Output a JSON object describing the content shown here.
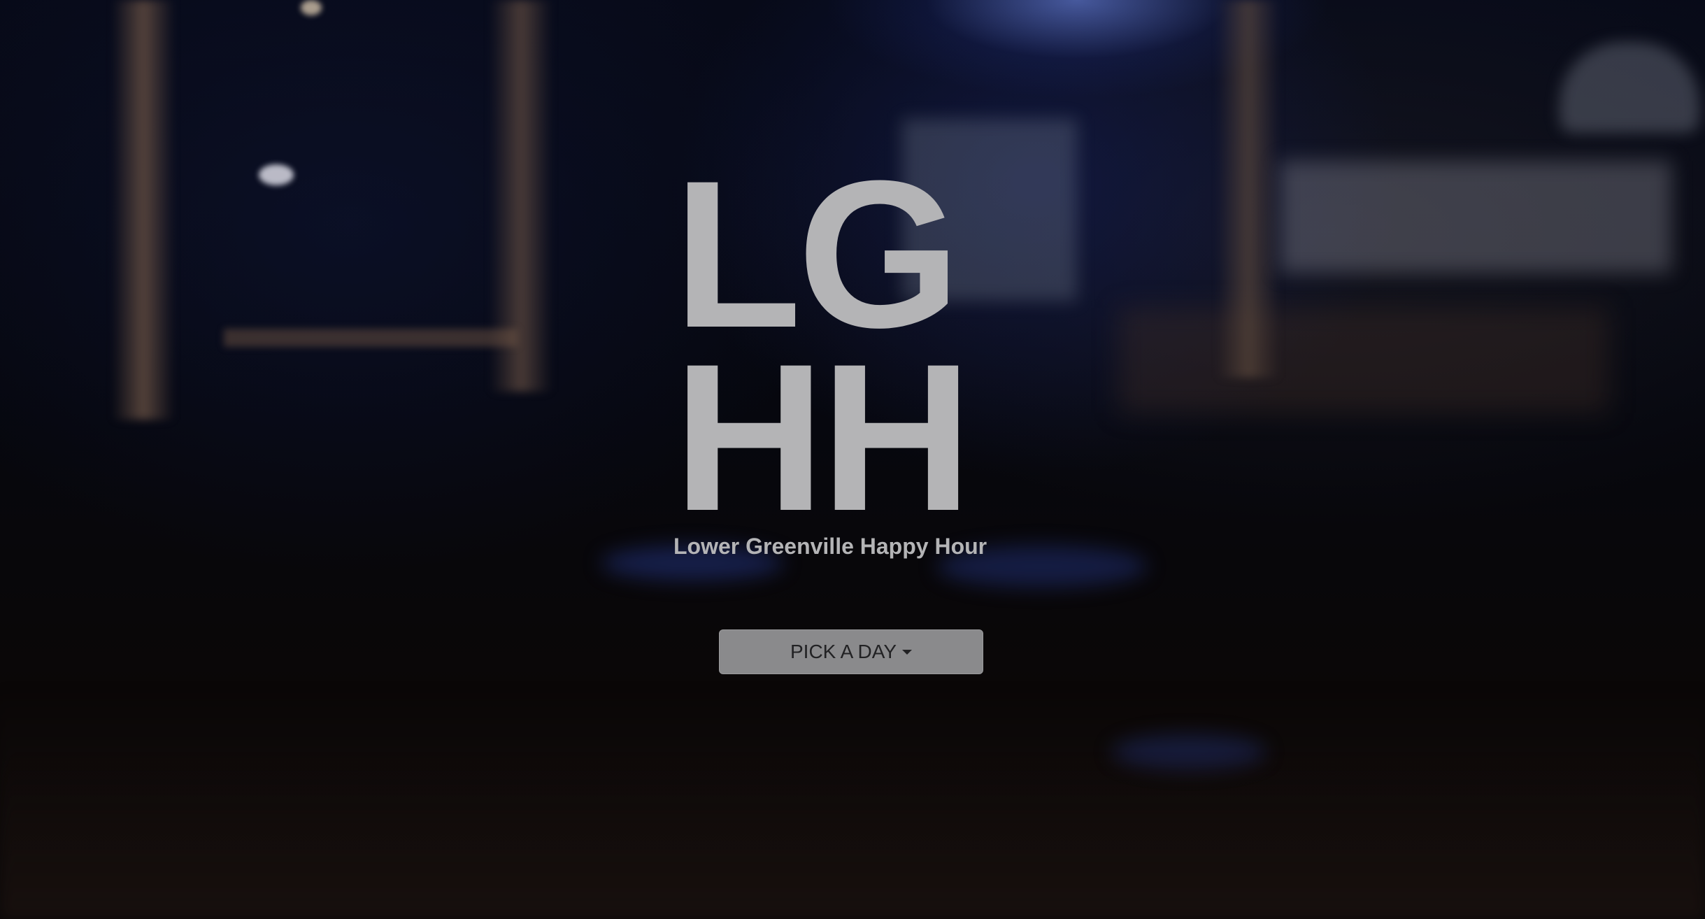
{
  "logo": {
    "line1": "LG",
    "line2": "HH",
    "subtitle": "Lower Greenville Happy Hour"
  },
  "day_picker": {
    "label": "PICK A DAY",
    "icon": "caret-down-icon"
  },
  "colors": {
    "logo_text": "#b4b4b6",
    "button_bg": "#8a8a8c",
    "button_text": "#222224",
    "background": "#05060c"
  }
}
